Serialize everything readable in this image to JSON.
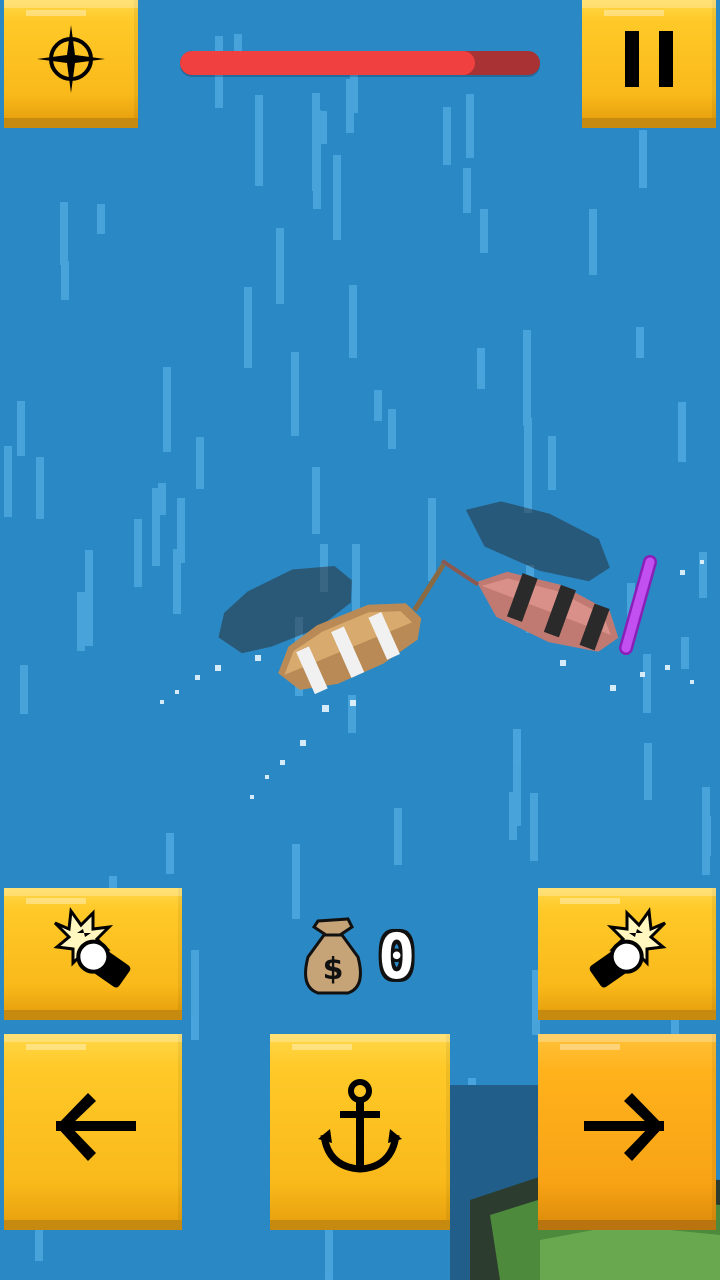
{
  "game": {
    "health_percent": 82,
    "coins": "0"
  },
  "hud": {
    "map_button_icon": "compass-icon",
    "pause_button_icon": "pause-icon",
    "coin_icon": "money-bag-icon"
  },
  "controls": {
    "fire_left_icon": "cannon-fire-left-icon",
    "fire_right_icon": "cannon-fire-right-icon",
    "turn_left_icon": "arrow-left-icon",
    "anchor_icon": "anchor-icon",
    "turn_right_icon": "arrow-right-icon"
  },
  "colors": {
    "sea": "#2a88c4",
    "button": "#ffc928",
    "health": "#f0403f",
    "health_bg": "#a83234",
    "enemy_marker": "#b03ee0"
  }
}
